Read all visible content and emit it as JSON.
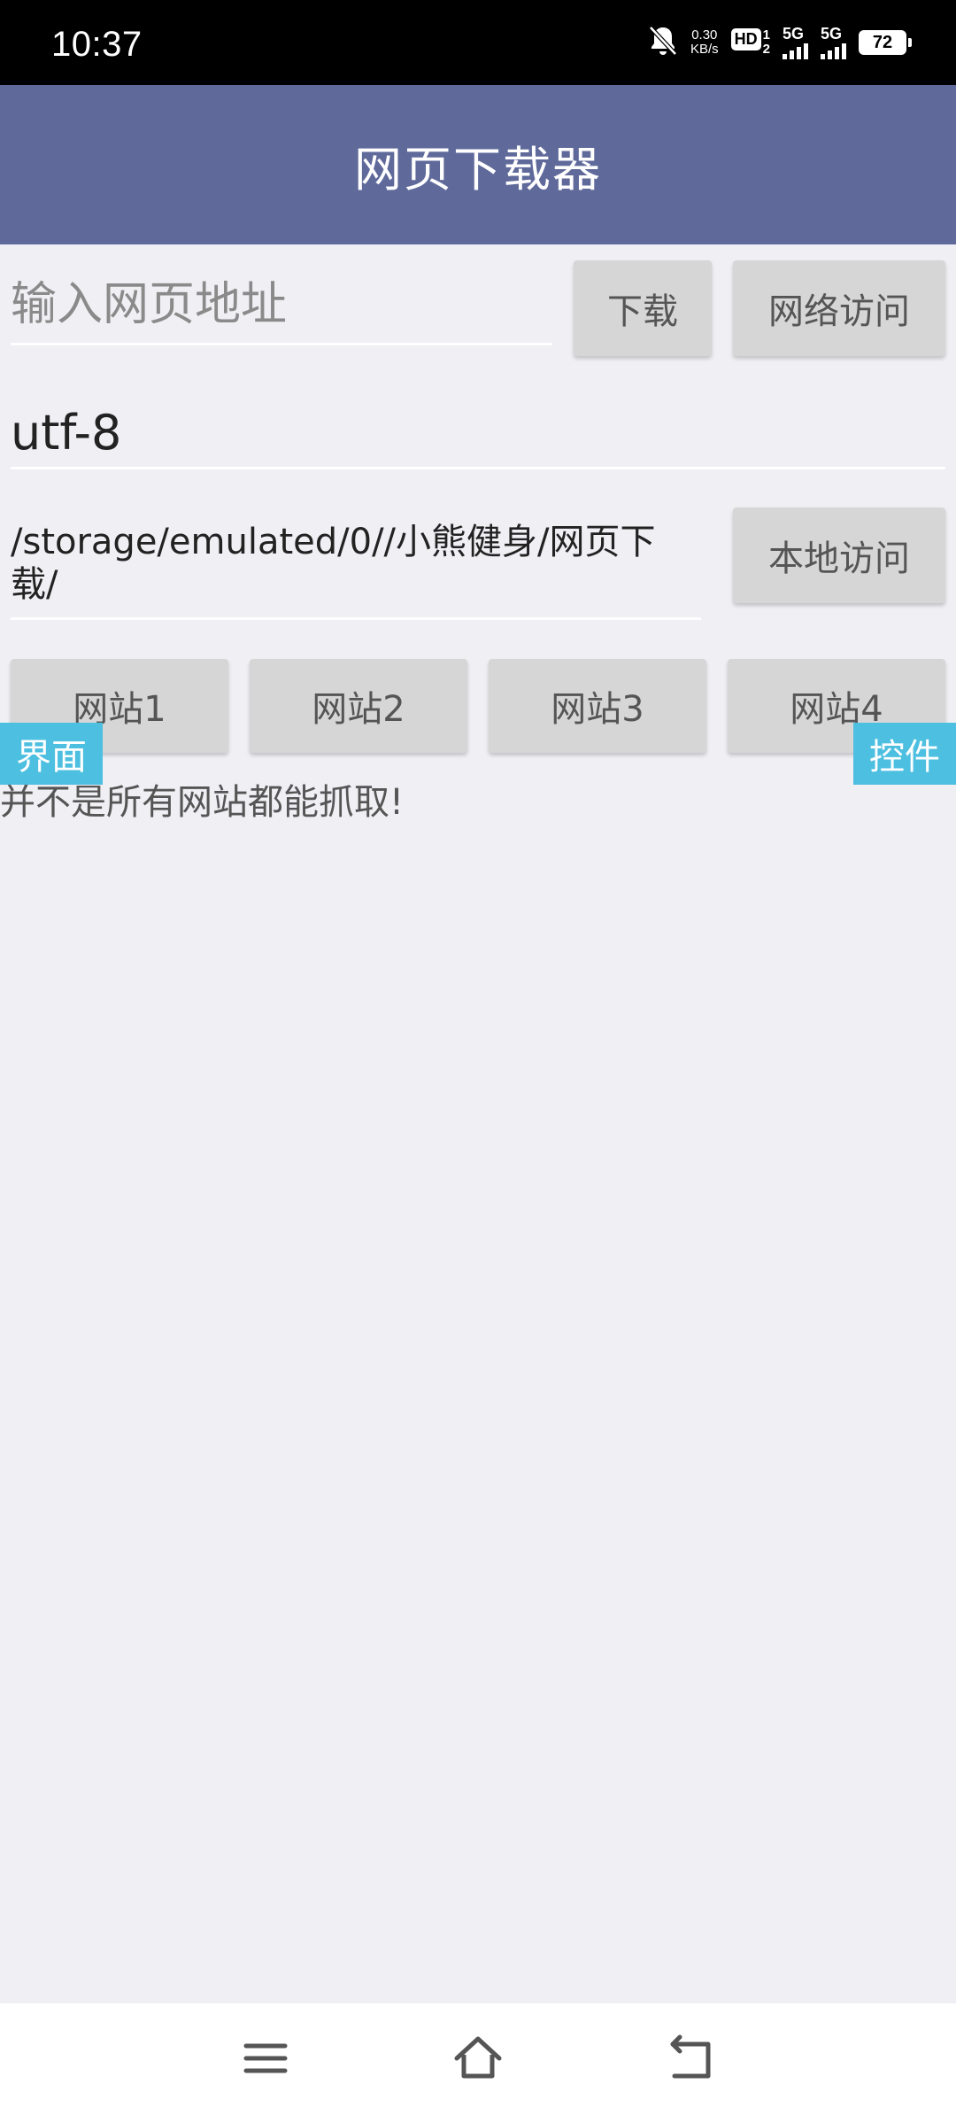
{
  "status_bar": {
    "time": "10:37",
    "net_speed_value": "0.30",
    "net_speed_unit": "KB/s",
    "hd_label": "HD",
    "hd_sub_top": "1",
    "hd_sub_bottom": "2",
    "signal1_label": "5G",
    "signal2_label": "5G",
    "battery_level": "72",
    "icons": [
      "mute-bell-icon",
      "signal-icon",
      "signal-icon",
      "battery-icon"
    ]
  },
  "app_bar": {
    "title": "网页下载器",
    "color": "#5f6a9b"
  },
  "form": {
    "url_placeholder": "输入网页地址",
    "url_value": "",
    "download_label": "下载",
    "web_visit_label": "网络访问",
    "encoding_value": "utf-8",
    "path_value": "/storage/emulated/0//小熊健身/网页下载/",
    "local_visit_label": "本地访问"
  },
  "sites": [
    {
      "label": "网站1"
    },
    {
      "label": "网站2"
    },
    {
      "label": "网站3"
    },
    {
      "label": "网站4"
    }
  ],
  "overlay_tags": {
    "left_label": "界面",
    "right_label": "控件",
    "color": "#4dbfe0"
  },
  "notice_text": "并不是所有网站都能抓取!",
  "nav_bar": {
    "icons": [
      "menu-icon",
      "home-icon",
      "back-icon"
    ]
  }
}
